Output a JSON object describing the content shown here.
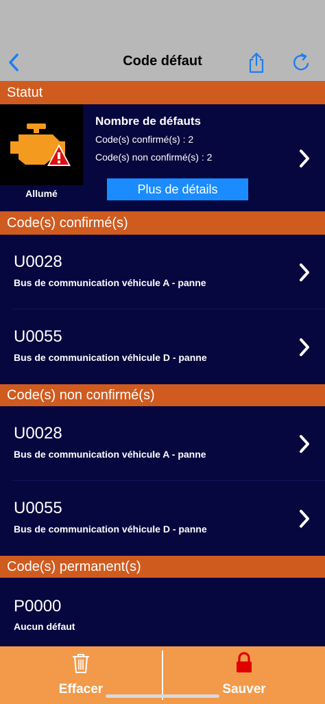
{
  "navbar": {
    "title": "Code défaut",
    "back_icon": "chevron-left-icon",
    "share_icon": "share-icon",
    "refresh_icon": "refresh-icon",
    "accent": "#1a7cf5"
  },
  "status": {
    "header": "Statut",
    "engine_state": "Allumé",
    "title": "Nombre de défauts",
    "confirmed_line": "Code(s) confirmé(s) : 2",
    "unconfirmed_line": "Code(s) non confirmé(s) : 2",
    "details_button": "Plus de détails"
  },
  "sections": {
    "confirmed": {
      "header": "Code(s) confirmé(s)",
      "items": [
        {
          "code": "U0028",
          "desc": "Bus de communication véhicule A - panne"
        },
        {
          "code": "U0055",
          "desc": "Bus de communication véhicule D - panne"
        }
      ]
    },
    "unconfirmed": {
      "header": "Code(s) non confirmé(s)",
      "items": [
        {
          "code": "U0028",
          "desc": "Bus de communication véhicule A - panne"
        },
        {
          "code": "U0055",
          "desc": "Bus de communication véhicule D - panne"
        }
      ]
    },
    "permanent": {
      "header": "Code(s) permanent(s)",
      "items": [
        {
          "code": "P0000",
          "desc": "Aucun défaut"
        }
      ]
    }
  },
  "bottom_bar": {
    "clear_label": "Effacer",
    "save_label": "Sauver",
    "clear_icon": "trash-icon",
    "save_icon": "lock-icon"
  },
  "colors": {
    "navbar_bg": "#b8b8b8",
    "section_header_bg": "#cf5b1f",
    "list_bg": "#07073f",
    "bottom_bar_bg": "#f29a4a",
    "details_button_bg": "#1a8cff",
    "lock_red": "#e00000"
  }
}
